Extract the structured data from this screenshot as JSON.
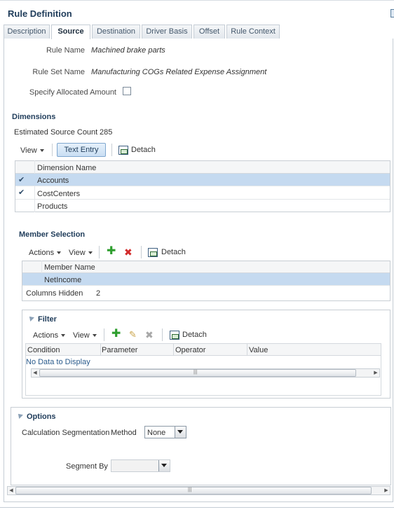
{
  "page": {
    "title": "Rule Definition"
  },
  "tabs": [
    {
      "label": "Description",
      "active": false
    },
    {
      "label": "Source",
      "active": true
    },
    {
      "label": "Destination",
      "active": false
    },
    {
      "label": "Driver Basis",
      "active": false
    },
    {
      "label": "Offset",
      "active": false
    },
    {
      "label": "Rule Context",
      "active": false
    }
  ],
  "form": {
    "rule_name_label": "Rule Name",
    "rule_name_value": "Machined brake parts",
    "rule_set_label": "Rule Set Name",
    "rule_set_value": "Manufacturing COGs Related Expense Assignment",
    "specify_label": "Specify Allocated Amount",
    "specify_checked": false
  },
  "dimensions": {
    "heading": "Dimensions",
    "estimated_label": "Estimated Source Count",
    "estimated_value": "285",
    "toolbar": {
      "view": "View",
      "text_entry": "Text Entry",
      "detach": "Detach"
    },
    "column": "Dimension Name",
    "rows": [
      {
        "name": "Accounts",
        "checked": true,
        "selected": true
      },
      {
        "name": "CostCenters",
        "checked": true,
        "selected": false
      },
      {
        "name": "Products",
        "checked": false,
        "selected": false
      }
    ]
  },
  "member_selection": {
    "heading": "Member Selection",
    "toolbar": {
      "actions": "Actions",
      "view": "View",
      "detach": "Detach"
    },
    "column": "Member Name",
    "rows": [
      {
        "name": "NetIncome",
        "selected": true
      }
    ],
    "columns_hidden_label": "Columns Hidden",
    "columns_hidden_value": "2"
  },
  "filter": {
    "heading": "Filter",
    "toolbar": {
      "actions": "Actions",
      "view": "View",
      "detach": "Detach"
    },
    "columns": [
      "Condition",
      "Parameter",
      "Operator",
      "Value"
    ],
    "empty_text": "No Data to Display"
  },
  "options": {
    "heading": "Options",
    "calc_label": "Calculation Segmentation",
    "method_label": "Method",
    "method_value": "None",
    "segment_by_label": "Segment By",
    "segment_by_value": ""
  },
  "colors": {
    "accent": "#1f3c5a",
    "selected_row": "#c5daf0"
  }
}
